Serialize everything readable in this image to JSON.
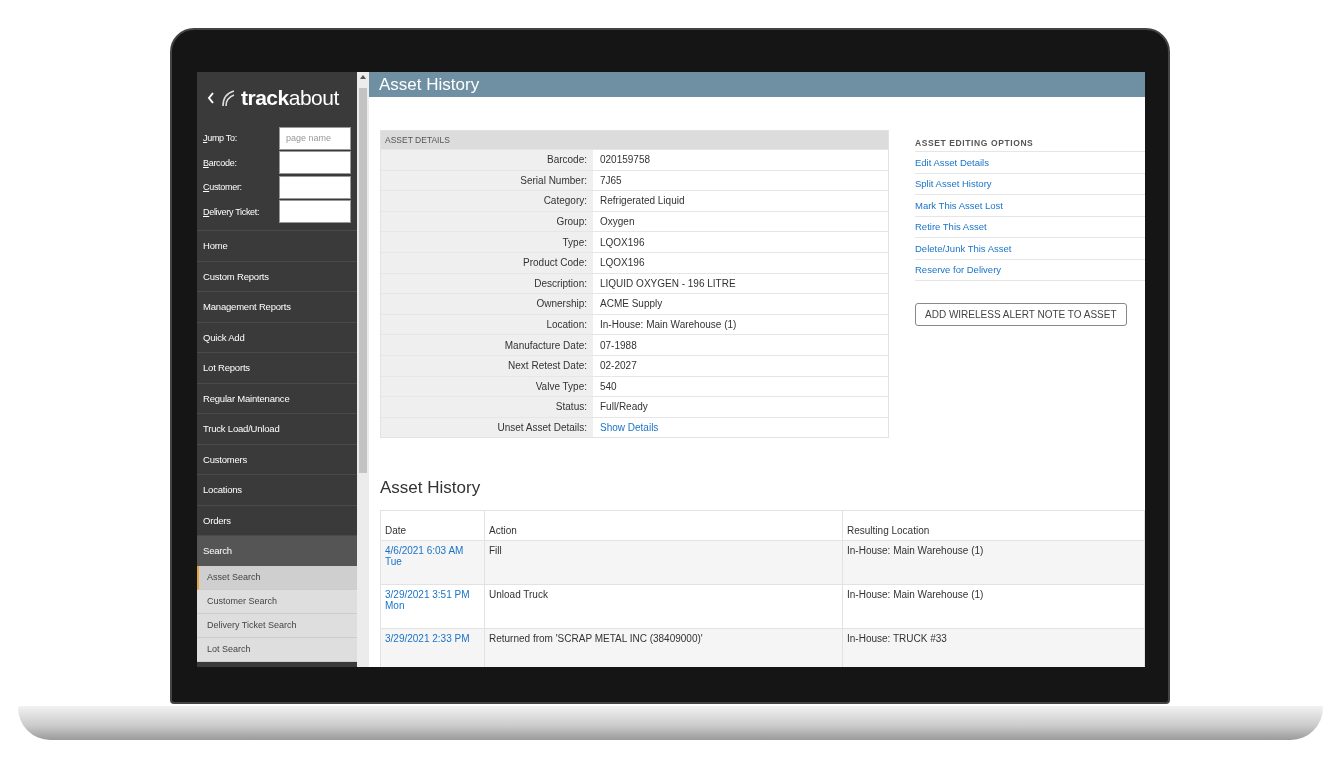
{
  "sidebar": {
    "logo": "**track**about",
    "quick_fields": [
      {
        "label": "Jump To:",
        "placeholder": "page name"
      },
      {
        "label": "Barcode:"
      },
      {
        "label": "Customer:"
      },
      {
        "label": "Delivery Ticket:"
      }
    ],
    "nav": [
      {
        "label": "Home",
        "expanded": false
      },
      {
        "label": "Custom Reports",
        "expanded": false
      },
      {
        "label": "Management Reports",
        "expanded": false
      },
      {
        "label": "Quick Add",
        "expanded": false
      },
      {
        "label": "Lot Reports",
        "expanded": false
      },
      {
        "label": "Regular Maintenance",
        "expanded": false
      },
      {
        "label": "Truck Load/Unload",
        "expanded": false
      },
      {
        "label": "Customers",
        "expanded": false
      },
      {
        "label": "Locations",
        "expanded": false
      },
      {
        "label": "Orders",
        "expanded": false
      },
      {
        "label": "Search",
        "expanded": true,
        "children": [
          {
            "label": "Asset Search",
            "selected": true
          },
          {
            "label": "Customer Search",
            "selected": false
          },
          {
            "label": "Delivery Ticket Search",
            "selected": false
          },
          {
            "label": "Lot Search",
            "selected": false
          }
        ]
      }
    ]
  },
  "page_title": "Asset History",
  "asset_details": {
    "heading": "ASSET DETAILS",
    "rows": [
      {
        "label": "Barcode:",
        "value": "020159758",
        "kind": "text"
      },
      {
        "label": "Serial Number:",
        "value": "7J65",
        "kind": "text"
      },
      {
        "label": "Category:",
        "value": "Refrigerated Liquid",
        "kind": "text"
      },
      {
        "label": "Group:",
        "value": "Oxygen",
        "kind": "text"
      },
      {
        "label": "Type:",
        "value": "LQOX196",
        "kind": "text"
      },
      {
        "label": "Product Code:",
        "value": "LQOX196",
        "kind": "text"
      },
      {
        "label": "Description:",
        "value": "LIQUID OXYGEN - 196 LITRE",
        "kind": "text"
      },
      {
        "label": "Ownership:",
        "value": "ACME Supply",
        "kind": "text"
      },
      {
        "label": "Location:",
        "value": "In-House: Main Warehouse (1)",
        "kind": "text"
      },
      {
        "label": "Manufacture Date:",
        "value": "07-1988",
        "kind": "text"
      },
      {
        "label": "Next Retest Date:",
        "value": "02-2027",
        "kind": "text"
      },
      {
        "label": "Valve Type:",
        "value": "540",
        "kind": "text"
      },
      {
        "label": "Status:",
        "value": "Full/Ready",
        "kind": "text"
      },
      {
        "label": "Unset Asset Details:",
        "value": "Show Details",
        "kind": "link"
      }
    ]
  },
  "editing_options": {
    "heading": "ASSET EDITING OPTIONS",
    "links": [
      "Edit Asset Details",
      "Split Asset History",
      "Mark This Asset Lost",
      "Retire This Asset",
      "Delete/Junk This Asset",
      "Reserve for Delivery"
    ],
    "button": "ADD WIRELESS ALERT NOTE TO ASSET"
  },
  "history": {
    "title": "Asset History",
    "columns": [
      "Date",
      "Action",
      "Resulting Location"
    ],
    "rows": [
      {
        "date": "4/6/2021 6:03 AM Tue",
        "action": "Fill",
        "location": "In-House: Main Warehouse (1)"
      },
      {
        "date": "3/29/2021 3:51 PM Mon",
        "action": "Unload Truck",
        "location": "In-House: Main Warehouse (1)"
      },
      {
        "date": "3/29/2021 2:33 PM",
        "action": "Returned from 'SCRAP METAL INC (38409000)'",
        "location": "In-House: TRUCK #33"
      }
    ]
  }
}
